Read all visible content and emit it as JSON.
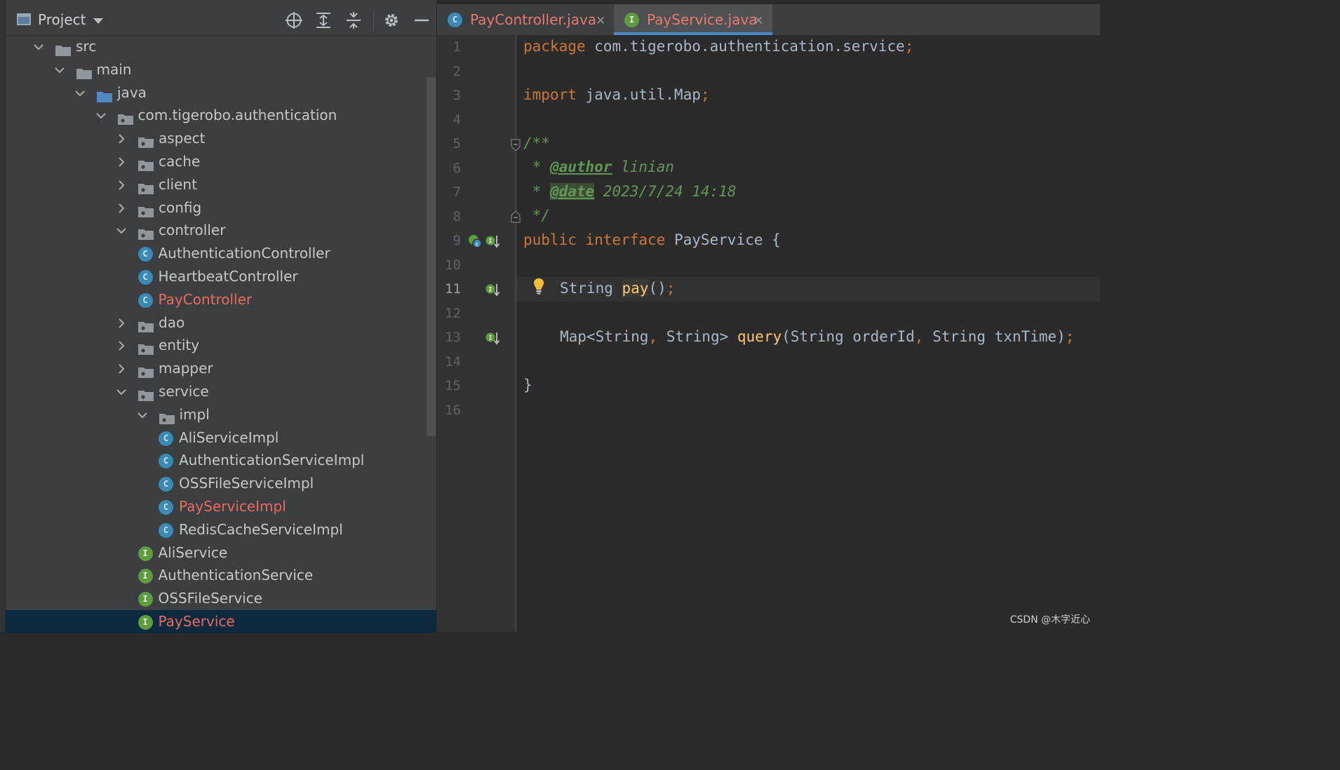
{
  "project_panel": {
    "title": "Project",
    "tree": [
      {
        "label": "src",
        "kind": "folder",
        "expanded": true,
        "depth": 0
      },
      {
        "label": "main",
        "kind": "folder",
        "expanded": true,
        "depth": 1
      },
      {
        "label": "java",
        "kind": "source-folder",
        "expanded": true,
        "depth": 2
      },
      {
        "label": "com.tigerobo.authentication",
        "kind": "package",
        "expanded": true,
        "depth": 3
      },
      {
        "label": "aspect",
        "kind": "package",
        "expanded": false,
        "depth": 4
      },
      {
        "label": "cache",
        "kind": "package",
        "expanded": false,
        "depth": 4
      },
      {
        "label": "client",
        "kind": "package",
        "expanded": false,
        "depth": 4
      },
      {
        "label": "config",
        "kind": "package",
        "expanded": false,
        "depth": 4
      },
      {
        "label": "controller",
        "kind": "package",
        "expanded": true,
        "depth": 4
      },
      {
        "label": "AuthenticationController",
        "kind": "class",
        "depth": 5
      },
      {
        "label": "HeartbeatController",
        "kind": "class",
        "depth": 5
      },
      {
        "label": "PayController",
        "kind": "class",
        "depth": 5,
        "modified": true
      },
      {
        "label": "dao",
        "kind": "package",
        "expanded": false,
        "depth": 4
      },
      {
        "label": "entity",
        "kind": "package",
        "expanded": false,
        "depth": 4
      },
      {
        "label": "mapper",
        "kind": "package",
        "expanded": false,
        "depth": 4
      },
      {
        "label": "service",
        "kind": "package",
        "expanded": true,
        "depth": 4
      },
      {
        "label": "impl",
        "kind": "package",
        "expanded": true,
        "depth": 5
      },
      {
        "label": "AliServiceImpl",
        "kind": "class",
        "depth": 6
      },
      {
        "label": "AuthenticationServiceImpl",
        "kind": "class",
        "depth": 6
      },
      {
        "label": "OSSFileServiceImpl",
        "kind": "class",
        "depth": 6
      },
      {
        "label": "PayServiceImpl",
        "kind": "class",
        "depth": 6,
        "modified": true
      },
      {
        "label": "RedisCacheServiceImpl",
        "kind": "class",
        "depth": 6
      },
      {
        "label": "AliService",
        "kind": "interface",
        "depth": 5
      },
      {
        "label": "AuthenticationService",
        "kind": "interface",
        "depth": 5
      },
      {
        "label": "OSSFileService",
        "kind": "interface",
        "depth": 5
      },
      {
        "label": "PayService",
        "kind": "interface",
        "depth": 5,
        "modified": true,
        "selected": true
      }
    ],
    "toolbar_icons": [
      "locate-icon",
      "expand-all-icon",
      "collapse-all-icon",
      "gear-icon",
      "hide-icon"
    ]
  },
  "tabs": [
    {
      "label": "PayController.java",
      "icon": "C",
      "active": false
    },
    {
      "label": "PayService.java",
      "icon": "I",
      "active": true
    }
  ],
  "editor": {
    "current_line": 11,
    "line_numbers": [
      "1",
      "2",
      "3",
      "4",
      "5",
      "6",
      "7",
      "8",
      "9",
      "10",
      "11",
      "12",
      "13",
      "14",
      "15",
      "16"
    ],
    "code": {
      "l1_kw": "package",
      "l1_rest": " com.tigerobo.authentication.service",
      "l1_semi": ";",
      "l3_kw": "import",
      "l3_rest": " java.util.Map",
      "l3_semi": ";",
      "l5": "/**",
      "l6_star": " * ",
      "l6_tag": "@author",
      "l6_val": " linian",
      "l7_star": " * ",
      "l7_tag": "@date",
      "l7_val": " 2023/7/24 14:18",
      "l8": " */",
      "l9_kw": "public interface",
      "l9_rest": " PayService {",
      "l11_type": "String ",
      "l11_fn": "pay",
      "l11_args": "()",
      "l11_semi": ";",
      "l13_a": "Map<String",
      "l13_comma1": ",",
      "l13_b": " String> ",
      "l13_fn": "query",
      "l13_c": "(String orderId",
      "l13_comma2": ",",
      "l13_d": " String txnTime)",
      "l13_semi": ";",
      "l15": "}"
    }
  },
  "watermark": "CSDN @木字近心",
  "colors": {
    "accent": "#4a88c7",
    "modified_file": "#e96b5d",
    "class_badge": "#3a8ab3",
    "interface_badge": "#5f9c3f",
    "selection": "#0d293e"
  }
}
